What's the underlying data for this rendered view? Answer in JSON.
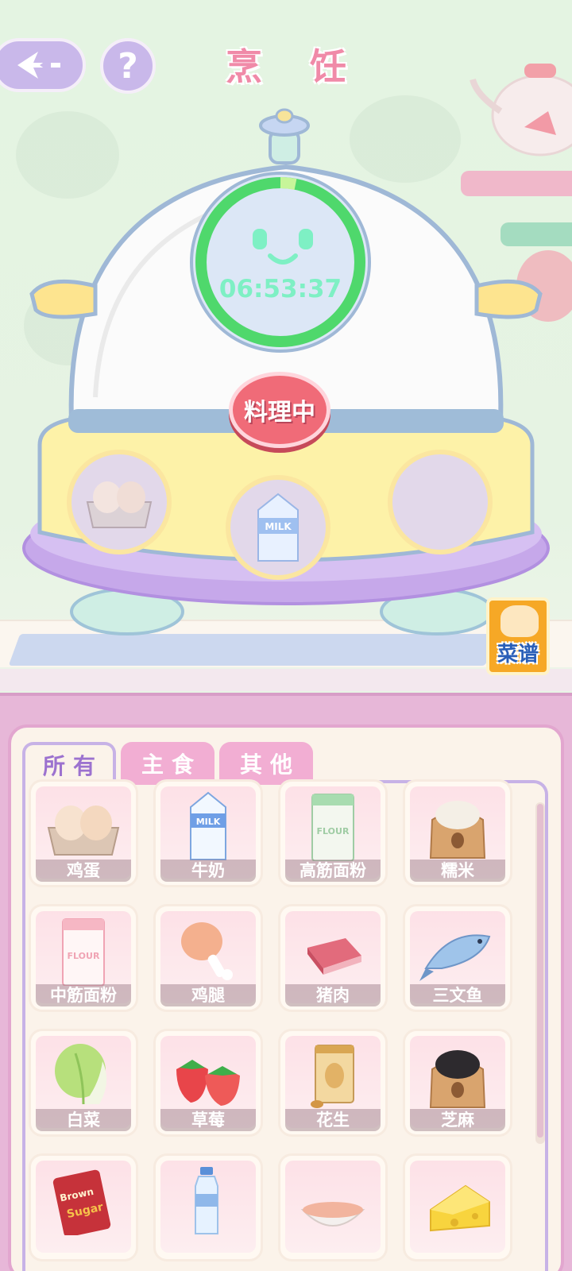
{
  "header": {
    "title": "烹 饪"
  },
  "cooker": {
    "timer": "06:53:37",
    "progress": 0.03,
    "status_button": "料理中",
    "slots": [
      "egg",
      "milk",
      "empty"
    ]
  },
  "recipe": {
    "label": "菜谱"
  },
  "tabs": [
    {
      "label": "所有",
      "active": true
    },
    {
      "label": "主食",
      "active": false
    },
    {
      "label": "其他",
      "active": false
    }
  ],
  "ingredients": [
    {
      "label": "鸡蛋",
      "icon": "egg-carton-icon"
    },
    {
      "label": "牛奶",
      "icon": "milk-carton-icon"
    },
    {
      "label": "高筋面粉",
      "icon": "bread-flour-bag-icon"
    },
    {
      "label": "糯米",
      "icon": "rice-sack-icon"
    },
    {
      "label": "中筋面粉",
      "icon": "flour-bag-icon"
    },
    {
      "label": "鸡腿",
      "icon": "chicken-leg-icon"
    },
    {
      "label": "猪肉",
      "icon": "pork-icon"
    },
    {
      "label": "三文鱼",
      "icon": "salmon-icon"
    },
    {
      "label": "白菜",
      "icon": "cabbage-icon"
    },
    {
      "label": "草莓",
      "icon": "strawberry-icon"
    },
    {
      "label": "花生",
      "icon": "peanut-bag-icon"
    },
    {
      "label": "芝麻",
      "icon": "sesame-sack-icon"
    },
    {
      "label": "",
      "icon": "brown-sugar-bag-icon"
    },
    {
      "label": "",
      "icon": "water-bottle-icon"
    },
    {
      "label": "",
      "icon": "bowl-icon"
    },
    {
      "label": "",
      "icon": "cheese-icon"
    }
  ],
  "colors": {
    "accent_pink": "#f08aa8",
    "accent_purple": "#c9b8ea",
    "timer_green": "#7ef0c4",
    "button_red": "#f06b78"
  }
}
